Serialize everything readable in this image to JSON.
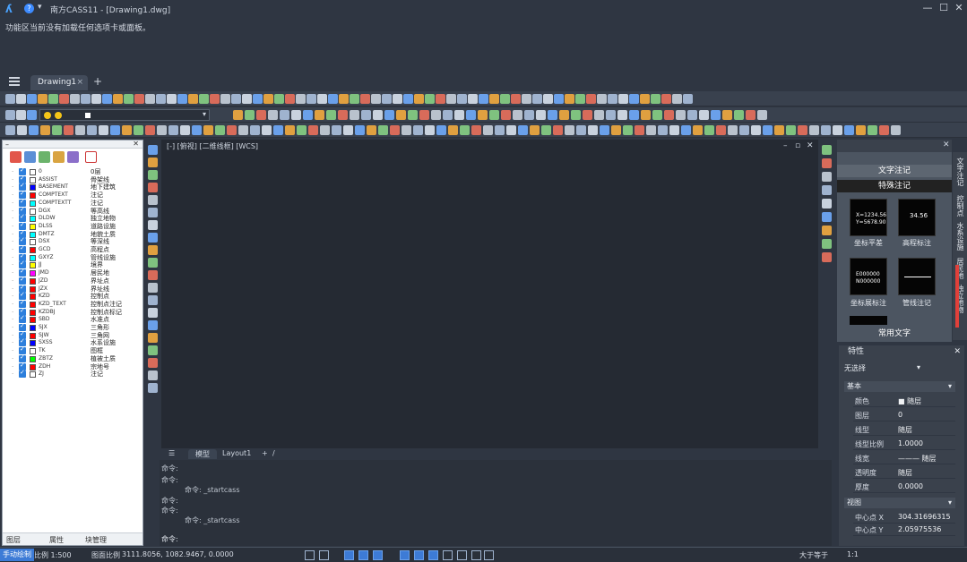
{
  "window": {
    "title": "南方CASS11 - [Drawing1.dwg]",
    "minimize": "—",
    "maximize": "☐",
    "close": "✕"
  },
  "hint": "功能区当前没有加载任何选项卡或面板。",
  "tabs": {
    "doc_tab": "Drawing1",
    "close_x": "×",
    "add": "+"
  },
  "layer_panel": {
    "layers": [
      {
        "name": "0",
        "desc": "0层",
        "color": "#ffffff"
      },
      {
        "name": "ASSIST",
        "desc": "骨架线",
        "color": "#ffffff"
      },
      {
        "name": "BASEMENT",
        "desc": "地下建筑",
        "color": "#0000ff"
      },
      {
        "name": "COMPTEXT",
        "desc": "注记",
        "color": "#ff0000"
      },
      {
        "name": "COMPTEXTT",
        "desc": "注记",
        "color": "#00ffff"
      },
      {
        "name": "DGX",
        "desc": "等高线",
        "color": "#ffffff"
      },
      {
        "name": "DLDW",
        "desc": "独立地物",
        "color": "#00ffff"
      },
      {
        "name": "DLSS",
        "desc": "道路设施",
        "color": "#ffff00"
      },
      {
        "name": "DMTZ",
        "desc": "地貌土质",
        "color": "#00ffff"
      },
      {
        "name": "DSX",
        "desc": "等深线",
        "color": "#ffffff"
      },
      {
        "name": "GCD",
        "desc": "高程点",
        "color": "#ff0000"
      },
      {
        "name": "GXYZ",
        "desc": "管线设施",
        "color": "#00ffff"
      },
      {
        "name": "JJ",
        "desc": "境界",
        "color": "#ffff00"
      },
      {
        "name": "JMD",
        "desc": "居民地",
        "color": "#ff00ff"
      },
      {
        "name": "JZD",
        "desc": "界址点",
        "color": "#ff0000"
      },
      {
        "name": "JZX",
        "desc": "界址线",
        "color": "#ff0000"
      },
      {
        "name": "KZD",
        "desc": "控制点",
        "color": "#ff0000"
      },
      {
        "name": "KZD_TEXT",
        "desc": "控制点注记",
        "color": "#ff0000"
      },
      {
        "name": "KZDBJ",
        "desc": "控制点标记",
        "color": "#ff0000"
      },
      {
        "name": "SBD",
        "desc": "水准点",
        "color": "#ff0000"
      },
      {
        "name": "SJX",
        "desc": "三角形",
        "color": "#0000ff"
      },
      {
        "name": "SJW",
        "desc": "三角网",
        "color": "#ff0000"
      },
      {
        "name": "SXSS",
        "desc": "水系设施",
        "color": "#0000ff"
      },
      {
        "name": "TK",
        "desc": "图框",
        "color": "#ffffff"
      },
      {
        "name": "ZBTZ",
        "desc": "植被土质",
        "color": "#00ff00"
      },
      {
        "name": "ZDH",
        "desc": "宗地号",
        "color": "#ff0000"
      },
      {
        "name": "ZJ",
        "desc": "注记",
        "color": "#ffffff"
      }
    ],
    "bottom_tabs": [
      "图层",
      "属性",
      "块管理"
    ]
  },
  "drawing": {
    "view_label": "[-] [俯视] [二维线框] [WCS]",
    "ctrl_min": "–",
    "ctrl_max": "▫",
    "ctrl_close": "✕"
  },
  "layout_tabs": {
    "menu": "☰",
    "model": "模型",
    "layout1": "Layout1",
    "add": "+",
    "slash": "/"
  },
  "command": {
    "lines": [
      "命令:",
      "命令:",
      "命令: _startcass",
      "命令:",
      "命令:",
      "命令: _startcass"
    ],
    "prompt": "命令:"
  },
  "text_panel": {
    "section1": "文字注记",
    "section2": "特殊注记",
    "items": [
      {
        "caption": "坐标平差",
        "thumb_text": "X=1234.56\nY=5678.90"
      },
      {
        "caption": "高程标注",
        "thumb_text": "34.56"
      },
      {
        "caption": "坐标展标注",
        "thumb_text": "E000000\nN000000"
      },
      {
        "caption": "管线注记",
        "thumb_text": ""
      }
    ],
    "footer": "常用文字",
    "side_tabs": [
      "文字注记",
      "控制点",
      "水系设施",
      "居民地",
      "独立地物"
    ]
  },
  "properties": {
    "header": "特性",
    "selection": "无选择",
    "group_basic": "基本",
    "rows": [
      {
        "k": "颜色",
        "v": "■ 随层"
      },
      {
        "k": "图层",
        "v": "0"
      },
      {
        "k": "线型",
        "v": "随层"
      },
      {
        "k": "线型比例",
        "v": "1.0000"
      },
      {
        "k": "线宽",
        "v": "——— 随层"
      },
      {
        "k": "透明度",
        "v": "随层"
      },
      {
        "k": "厚度",
        "v": "0.0000"
      }
    ],
    "group_view": "视图",
    "view_rows": [
      {
        "k": "中心点 X",
        "v": "304.31696315"
      },
      {
        "k": "中心点 Y",
        "v": "2.05975536"
      }
    ]
  },
  "status": {
    "mode": "手动绘制",
    "scale": "比例 1:500",
    "drawing_scale": "图面比例",
    "coords": "3111.8056, 1082.9467, 0.0000",
    "extra": "1:1",
    "right_text": "大于等于"
  }
}
